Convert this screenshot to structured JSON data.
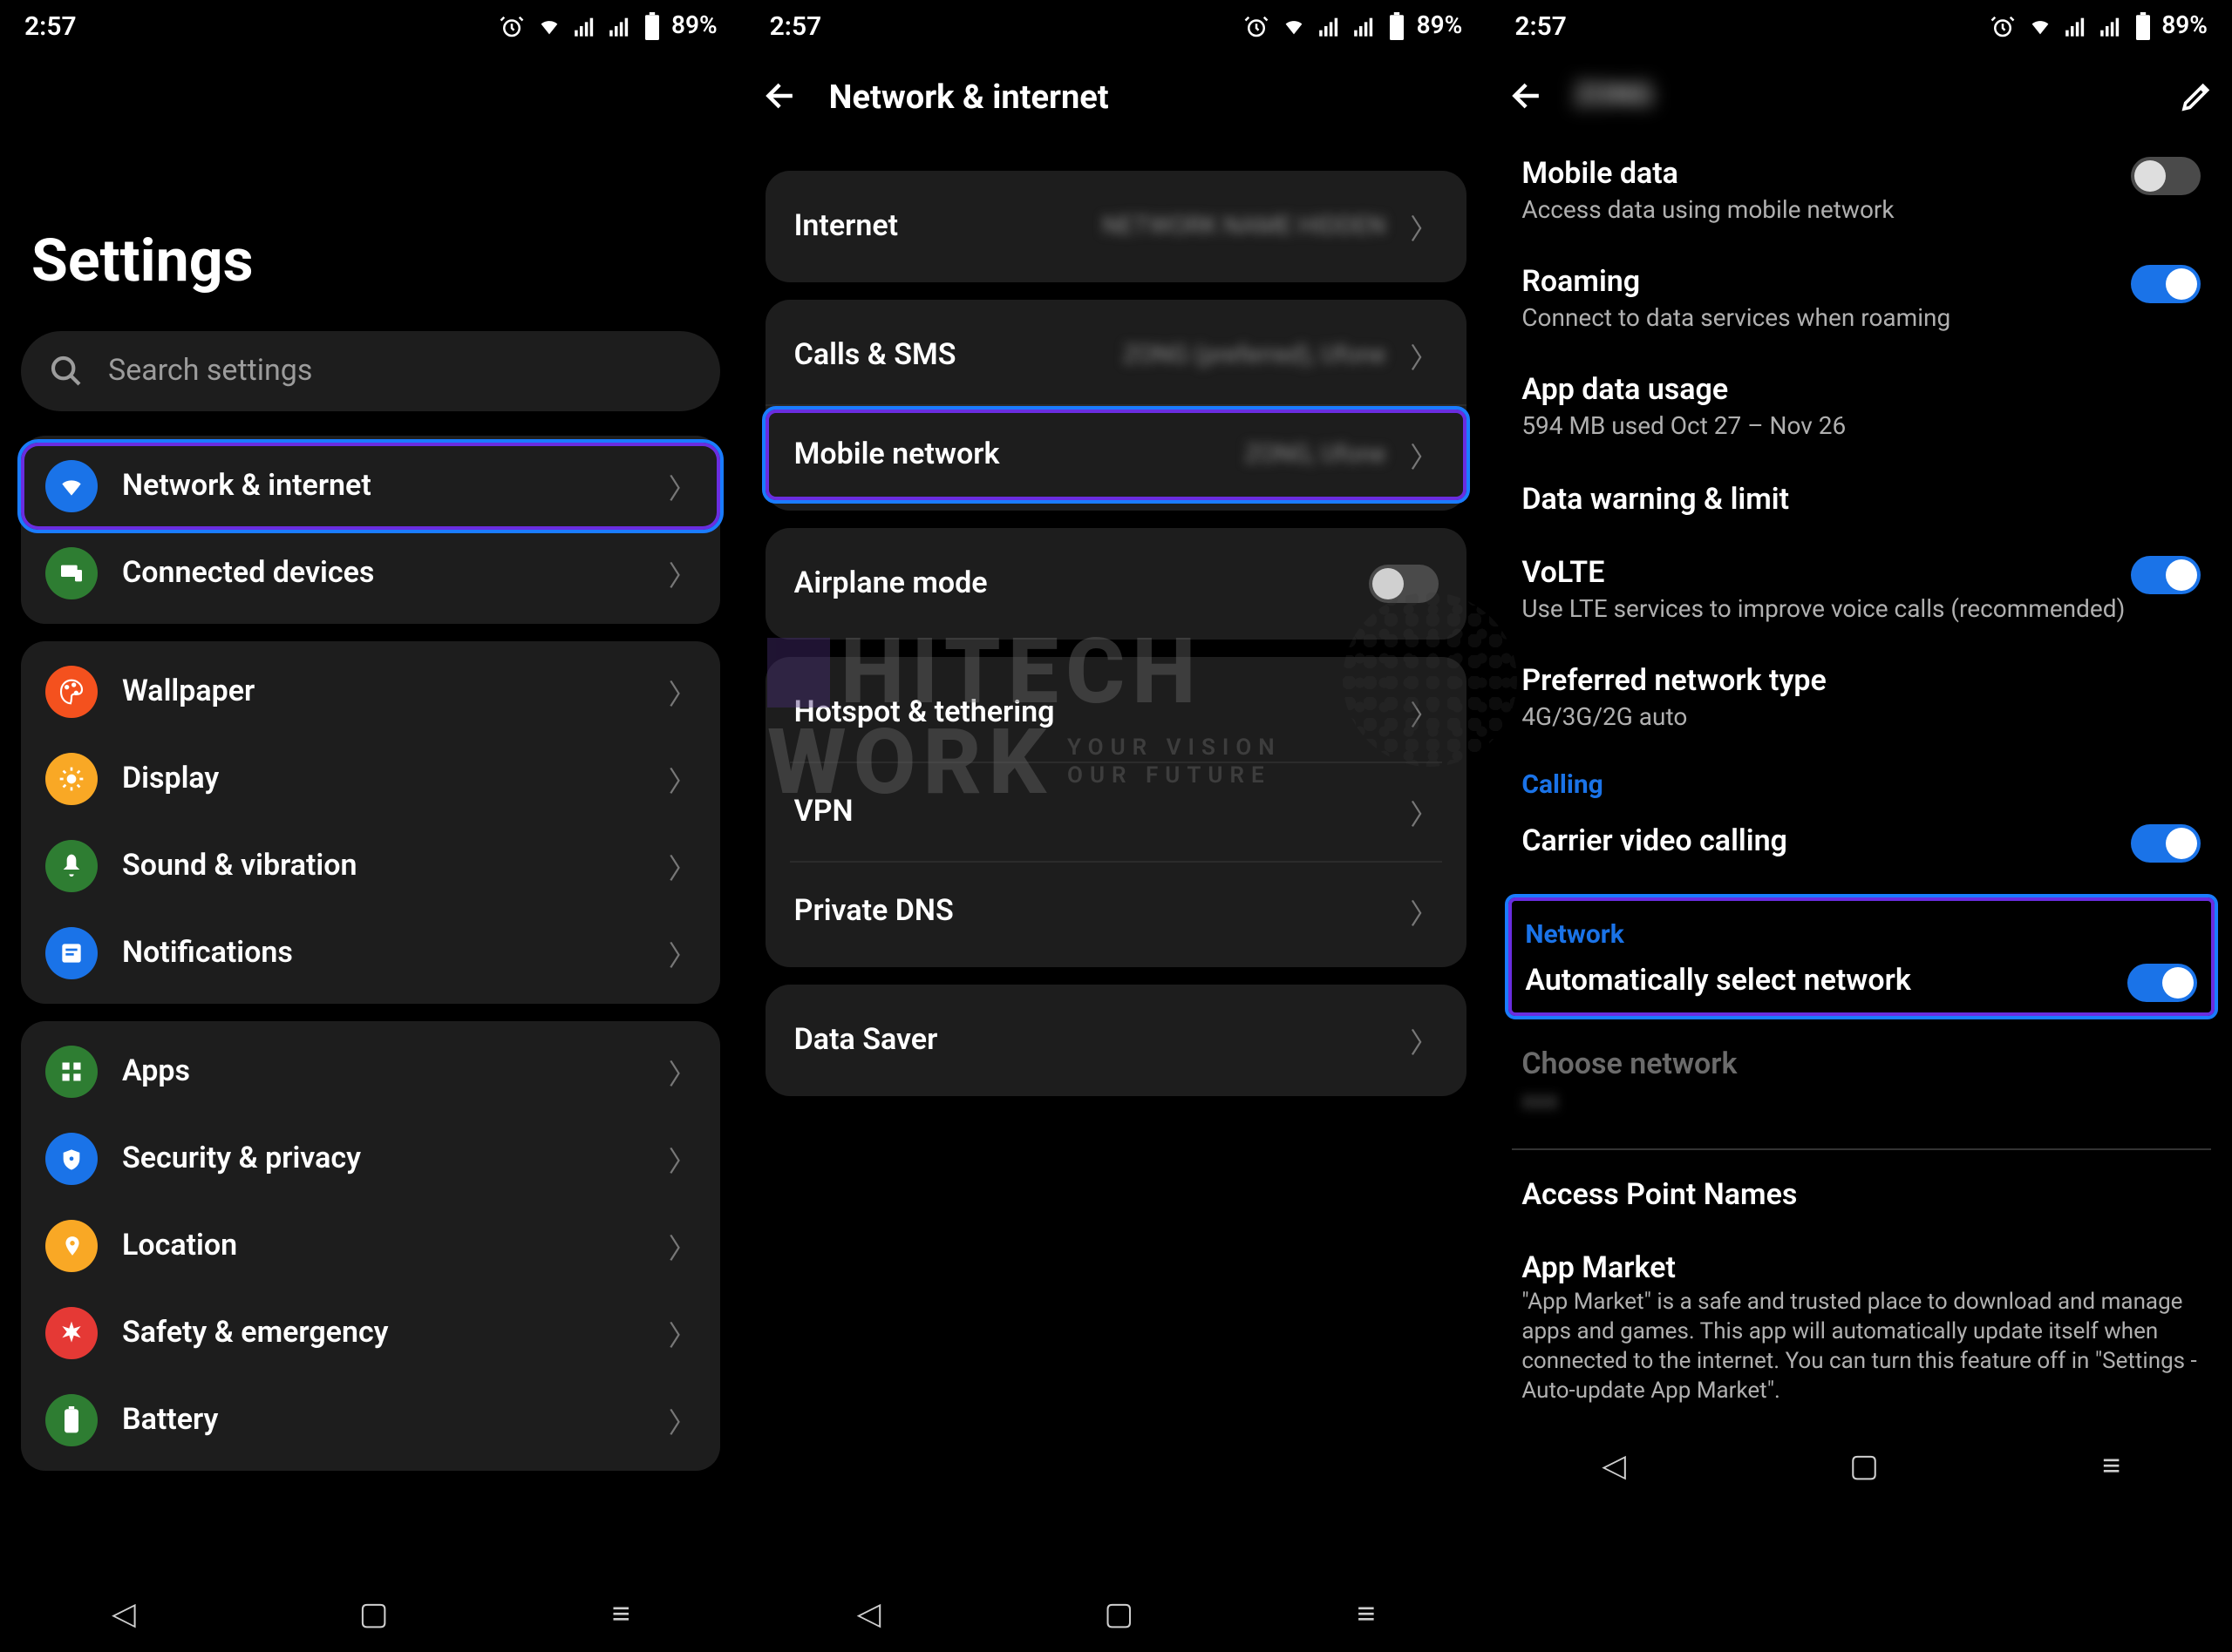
{
  "status": {
    "time": "2:57",
    "battery": "89%"
  },
  "screen1": {
    "title": "Settings",
    "search_placeholder": "Search settings",
    "group1": [
      "Network & internet",
      "Connected devices"
    ],
    "group2": [
      "Wallpaper",
      "Display",
      "Sound & vibration",
      "Notifications"
    ],
    "group3": [
      "Apps",
      "Security & privacy",
      "Location",
      "Safety & emergency",
      "Battery"
    ]
  },
  "screen2": {
    "heading": "Network & internet",
    "items": [
      {
        "label": "Internet",
        "sub": "NETWORK NAME HIDDEN"
      },
      {
        "label": "Calls & SMS",
        "sub": "ZONG (preferred), Ufone"
      },
      {
        "label": "Mobile network",
        "sub": "ZONG, Ufone",
        "highlight": true
      },
      {
        "label": "Airplane mode",
        "toggle": "off"
      },
      {
        "label": "Hotspot & tethering"
      },
      {
        "label": "VPN"
      },
      {
        "label": "Private DNS"
      },
      {
        "label": "Data Saver"
      }
    ]
  },
  "screen3": {
    "heading_blurred": "ZONG",
    "items": [
      {
        "title": "Mobile data",
        "subtitle": "Access data using mobile network",
        "toggle": "off-el"
      },
      {
        "title": "Roaming",
        "subtitle": "Connect to data services when roaming",
        "toggle": "on"
      },
      {
        "title": "App data usage",
        "subtitle": "594 MB used Oct 27 – Nov 26"
      },
      {
        "title": "Data warning & limit"
      },
      {
        "title": "VoLTE",
        "subtitle": "Use LTE services to improve voice calls (recommended)",
        "toggle": "on"
      },
      {
        "title": "Preferred network type",
        "subtitle": "4G/3G/2G auto"
      }
    ],
    "section_calling": "Calling",
    "carrier_video": {
      "title": "Carrier video calling",
      "toggle": "on"
    },
    "section_network": "Network",
    "auto_select": {
      "title": "Automatically select network",
      "toggle": "on"
    },
    "choose_net": "Choose network",
    "apn": "Access Point Names",
    "market_title": "App Market",
    "market_body": "\"App Market\" is a safe and trusted place to download and manage apps and games. This app will automatically update itself when connected to the internet. You can turn this feature off in \"Settings - Auto-update App Market\"."
  },
  "watermark": {
    "line1": "HITECH",
    "line2": "WORK",
    "tag1": "YOUR VISION",
    "tag2": "OUR FUTURE"
  }
}
